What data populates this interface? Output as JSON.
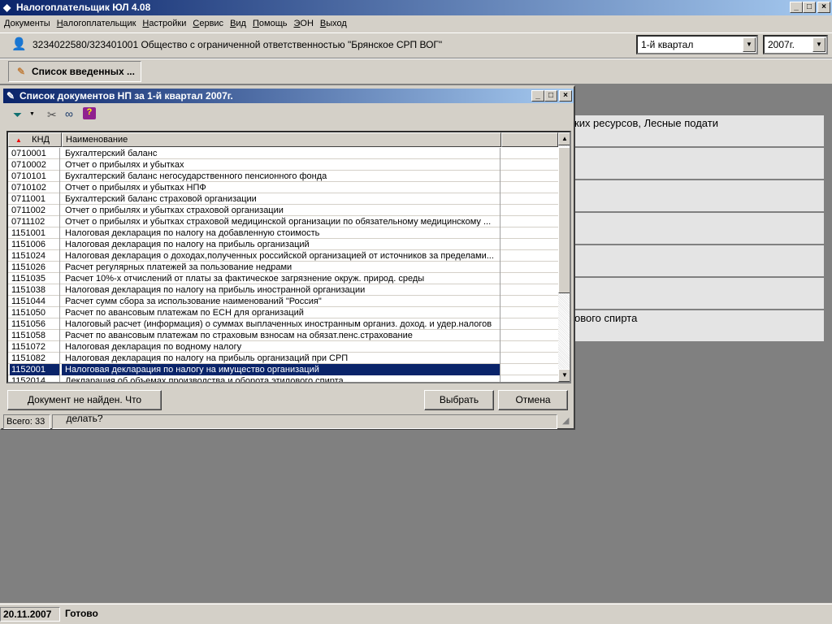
{
  "app": {
    "title": "Налогоплательщик ЮЛ 4.08",
    "window_controls": [
      "_",
      "□",
      "×"
    ]
  },
  "menu": [
    "Документы",
    "Налогоплательщик",
    "Настройки",
    "Сервис",
    "Вид",
    "Помощь",
    "ЭОН",
    "Выход"
  ],
  "org": {
    "text": "3234022580/323401001 Общество с ограниченной ответственностью \"Брянское СРП ВОГ\"",
    "period": "1-й квартал",
    "year": "2007г."
  },
  "tab": {
    "label": "Список введенных ..."
  },
  "background_panels": [
    "ких ресурсов, Лесные подати",
    "",
    "",
    "",
    "",
    "",
    "ового спирта"
  ],
  "dialog": {
    "title": "Список документов НП за 1-й квартал 2007г.",
    "toolbar_icons": [
      "filter-icon",
      "tools-icon",
      "binoculars-icon",
      "help-book-icon"
    ],
    "columns": [
      "КНД",
      "Наименование"
    ],
    "rows": [
      [
        "0710001",
        "Бухгалтерский баланс"
      ],
      [
        "0710002",
        "Отчет о прибылях и убытках"
      ],
      [
        "0710101",
        "Бухгалтерский баланс негосударственного пенсионного фонда"
      ],
      [
        "0710102",
        "Отчет о прибылях и убытках НПФ"
      ],
      [
        "0711001",
        "Бухгалтерский баланс страховой организации"
      ],
      [
        "0711002",
        "Отчет о прибылях и убытках страховой организации"
      ],
      [
        "0711102",
        "Отчет о прибылях и убытках страховой медицинской организации по обязательному медицинскому ..."
      ],
      [
        "1151001",
        "Налоговая декларация по налогу на добавленную стоимость"
      ],
      [
        "1151006",
        "Налоговая декларация по налогу на прибыль организаций"
      ],
      [
        "1151024",
        "Налоговая декларация о доходах,полученных российской организацией от источников за пределами..."
      ],
      [
        "1151026",
        "Расчет регулярных платежей за пользование недрами"
      ],
      [
        "1151035",
        "Расчет 10%-х отчислений от платы за фактическое загрязнение окруж. природ. среды"
      ],
      [
        "1151038",
        "Налоговая декларация по налогу на прибыль иностранной организации"
      ],
      [
        "1151044",
        "Расчет сумм сбора за использование наименований \"Россия\""
      ],
      [
        "1151050",
        "Расчет по авансовым платежам по ЕСН для организаций"
      ],
      [
        "1151056",
        "Налоговый расчет (информация) о суммах выплаченных иностранным организ. доход. и удер.налогов"
      ],
      [
        "1151058",
        "Расчет по авансовым платежам по страховым взносам на обязат.пенс.страхование"
      ],
      [
        "1151072",
        "Налоговая декларация по водному налогу"
      ],
      [
        "1151082",
        "Налоговая декларация по налогу на прибыль организаций при СРП"
      ],
      [
        "1152001",
        "Налоговая декларация по налогу на имущество организаций"
      ],
      [
        "1152014",
        "Декларация об объемах производства и оборота этилового спирта"
      ]
    ],
    "selected_index": 19,
    "not_found_button": "Документ не найден. Что делать?",
    "select_button": "Выбрать",
    "cancel_button": "Отмена",
    "total": "Всего: 33"
  },
  "statusbar": {
    "date": "20.11.2007",
    "status": "Готово"
  }
}
